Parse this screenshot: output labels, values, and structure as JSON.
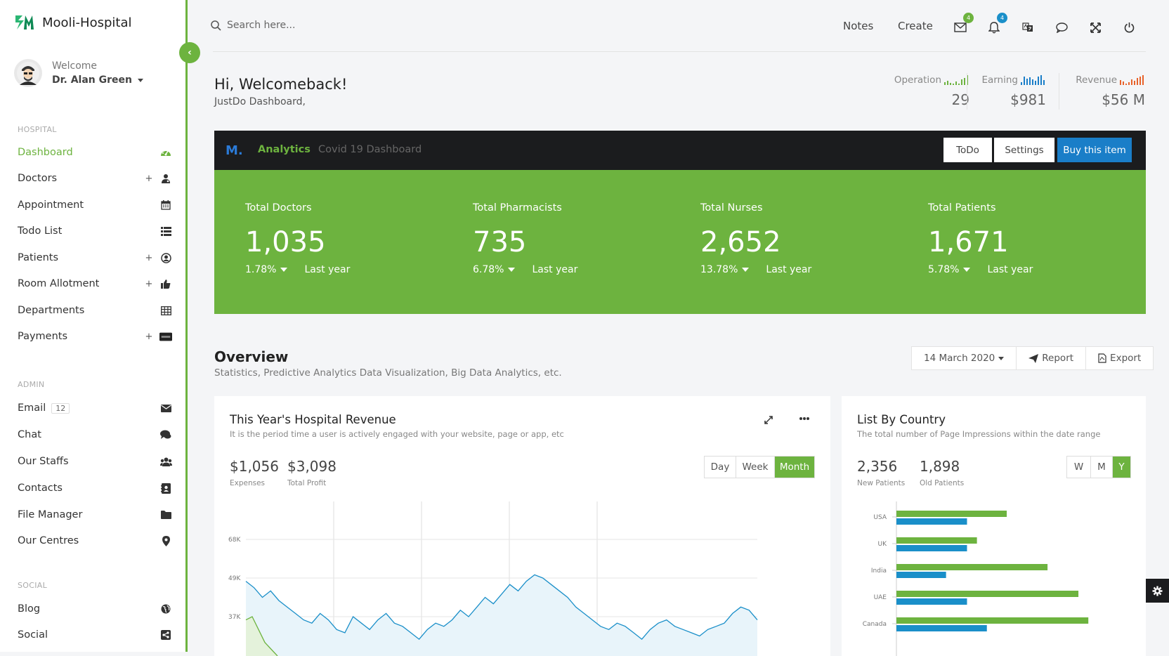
{
  "brand": {
    "name": "Mooli-Hospital"
  },
  "user": {
    "welcome": "Welcome",
    "name": "Dr. Alan Green"
  },
  "sidebar": {
    "hospital_label": "HOSPITAL",
    "admin_label": "ADMIN",
    "social_label": "SOCIAL",
    "hospital_items": [
      {
        "label": "Dashboard",
        "icon": "dashboard-icon",
        "plus": false,
        "active": true
      },
      {
        "label": "Doctors",
        "icon": "doctor-icon",
        "plus": true
      },
      {
        "label": "Appointment",
        "icon": "calendar-icon",
        "plus": false
      },
      {
        "label": "Todo List",
        "icon": "list-icon",
        "plus": false
      },
      {
        "label": "Patients",
        "icon": "user-circle-icon",
        "plus": true
      },
      {
        "label": "Room Allotment",
        "icon": "thumbs-up-icon",
        "plus": true
      },
      {
        "label": "Departments",
        "icon": "table-icon",
        "plus": false
      },
      {
        "label": "Payments",
        "icon": "paypal-icon",
        "plus": true
      }
    ],
    "admin_items": [
      {
        "label": "Email",
        "icon": "envelope-icon",
        "badge": "12"
      },
      {
        "label": "Chat",
        "icon": "chat-icon"
      },
      {
        "label": "Our Staffs",
        "icon": "users-icon"
      },
      {
        "label": "Contacts",
        "icon": "address-book-icon"
      },
      {
        "label": "File Manager",
        "icon": "folder-icon"
      },
      {
        "label": "Our Centres",
        "icon": "map-pin-icon"
      }
    ],
    "social_items": [
      {
        "label": "Blog",
        "icon": "globe-icon"
      },
      {
        "label": "Social",
        "icon": "share-icon"
      }
    ]
  },
  "header": {
    "search_placeholder": "Search here...",
    "notes": "Notes",
    "create": "Create",
    "mail_count": "4",
    "bell_count": "4"
  },
  "welcome": {
    "title": "Hi, Welcomeback!",
    "subtitle": "JustDo Dashboard,"
  },
  "stats": [
    {
      "label": "Operation",
      "value": "29",
      "color": "#6db33f"
    },
    {
      "label": "Earning",
      "value": "$981",
      "color": "#1a7ec8"
    },
    {
      "label": "Revenue",
      "value": "$56 M",
      "color": "#e8622a"
    }
  ],
  "analytics": {
    "logo": "M.",
    "tab_active": "Analytics",
    "tab_other": "Covid 19 Dashboard",
    "todo": "ToDo",
    "settings": "Settings",
    "buy": "Buy this item"
  },
  "totals": [
    {
      "label": "Total Doctors",
      "value": "1,035",
      "pct": "1.78%",
      "period": "Last year"
    },
    {
      "label": "Total Pharmacists",
      "value": "735",
      "pct": "6.78%",
      "period": "Last year"
    },
    {
      "label": "Total Nurses",
      "value": "2,652",
      "pct": "13.78%",
      "period": "Last year"
    },
    {
      "label": "Total Patients",
      "value": "1,671",
      "pct": "5.78%",
      "period": "Last year"
    }
  ],
  "overview": {
    "title": "Overview",
    "subtitle": "Statistics, Predictive Analytics Data Visualization, Big Data Analytics, etc.",
    "date": "14 March 2020",
    "report": "Report",
    "export": "Export"
  },
  "revenue_card": {
    "title": "This Year's Hospital Revenue",
    "subtitle": "It is the period time a user is actively engaged with your website, page or app, etc",
    "expenses_value": "$1,056",
    "expenses_label": "Expenses",
    "profit_value": "$3,098",
    "profit_label": "Total Profit",
    "ranges": [
      "Day",
      "Week",
      "Month"
    ],
    "active_range": "Month"
  },
  "country_card": {
    "title": "List By Country",
    "subtitle": "The total number of Page Impressions within the date range",
    "new_value": "2,356",
    "new_label": "New Patients",
    "old_value": "1,898",
    "old_label": "Old Patients",
    "ranges": [
      "W",
      "M",
      "Y"
    ],
    "active_range": "Y"
  },
  "chart_data": [
    {
      "type": "line",
      "yticks": [
        "68K",
        "49K",
        "37K"
      ],
      "series": [
        {
          "values": [
            48,
            46,
            43,
            45,
            42,
            40,
            38,
            36,
            35,
            38,
            36,
            33,
            32,
            37,
            35,
            33,
            36,
            38,
            35,
            34,
            32,
            30,
            33,
            35,
            34,
            36,
            39,
            37,
            40,
            43,
            41,
            44,
            47,
            45,
            48,
            50,
            49,
            47,
            45,
            43,
            40,
            38,
            36,
            34,
            33,
            35,
            34,
            32,
            30,
            33,
            35,
            36,
            34,
            33,
            32,
            31,
            33,
            34,
            35,
            38,
            40,
            39,
            36
          ],
          "color": "#1a8fc9"
        },
        {
          "values": [
            36,
            37,
            33,
            29
          ],
          "color": "#6db33f"
        }
      ]
    },
    {
      "type": "bar",
      "categories": [
        "USA",
        "UK",
        "India",
        "UAE",
        "Canada"
      ],
      "series": [
        {
          "values": [
            100,
            73,
            137,
            165,
            174
          ],
          "color": "#6db33f"
        },
        {
          "values": [
            64,
            64,
            45,
            64,
            82
          ],
          "color": "#1a8fc9"
        }
      ]
    }
  ],
  "colors": {
    "accent": "#6db33f",
    "blue": "#1a8fc9",
    "dark": "#1b1c1e"
  }
}
